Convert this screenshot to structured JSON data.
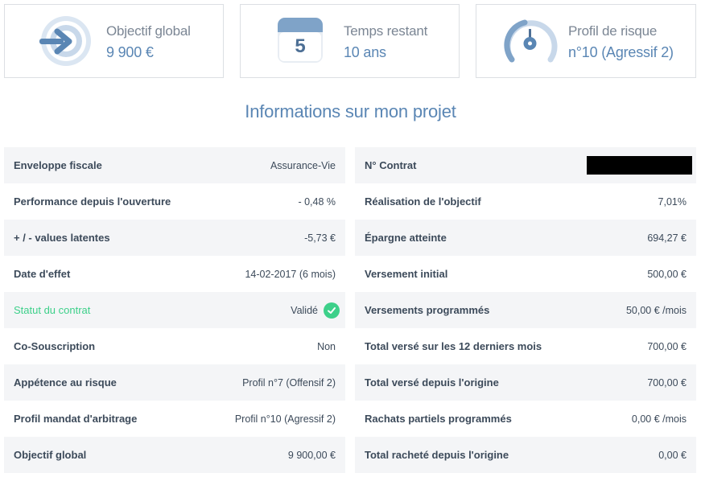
{
  "cards": [
    {
      "title": "Objectif global",
      "value": "9 900 €",
      "icon": "target-arrow-icon"
    },
    {
      "title": "Temps restant",
      "value": "10 ans",
      "icon": "calendar-icon",
      "calendar_number": "5"
    },
    {
      "title": "Profil de risque",
      "value": "n°10 (Agressif 2)",
      "icon": "gauge-icon"
    }
  ],
  "section_title": "Informations sur mon projet",
  "left_rows": [
    {
      "label": "Enveloppe fiscale",
      "value": "Assurance-Vie"
    },
    {
      "label": "Performance depuis l'ouverture",
      "value": "- 0,48 %"
    },
    {
      "label": "+ / - values latentes",
      "value": "-5,73 €"
    },
    {
      "label": "Date d'effet",
      "value": "14-02-2017 (6 mois)"
    },
    {
      "label": "Statut du contrat",
      "value": "Validé"
    },
    {
      "label": "Co-Souscription",
      "value": "Non"
    },
    {
      "label": "Appétence au risque",
      "value": "Profil n°7 (Offensif 2)"
    },
    {
      "label": "Profil mandat d'arbitrage",
      "value": "Profil n°10 (Agressif 2)"
    },
    {
      "label": "Objectif global",
      "value": "9 900,00 €"
    }
  ],
  "right_rows": [
    {
      "label": "N° Contrat",
      "value": ""
    },
    {
      "label": "Réalisation de l'objectif",
      "value": "7,01%"
    },
    {
      "label": "Épargne atteinte",
      "value": "694,27 €"
    },
    {
      "label": "Versement initial",
      "value": "500,00 €"
    },
    {
      "label": "Versements programmés",
      "value": "50,00 € /mois"
    },
    {
      "label": "Total versé sur les 12 derniers mois",
      "value": "700,00 €"
    },
    {
      "label": "Total versé depuis l'origine",
      "value": "700,00 €"
    },
    {
      "label": "Rachats partiels programmés",
      "value": "0,00 € /mois"
    },
    {
      "label": "Total racheté depuis l'origine",
      "value": "0,00 €"
    }
  ],
  "colors": {
    "accent": "#5a86b4",
    "status_ok": "#3dd08a",
    "row_alt": "#f4f5f7"
  }
}
